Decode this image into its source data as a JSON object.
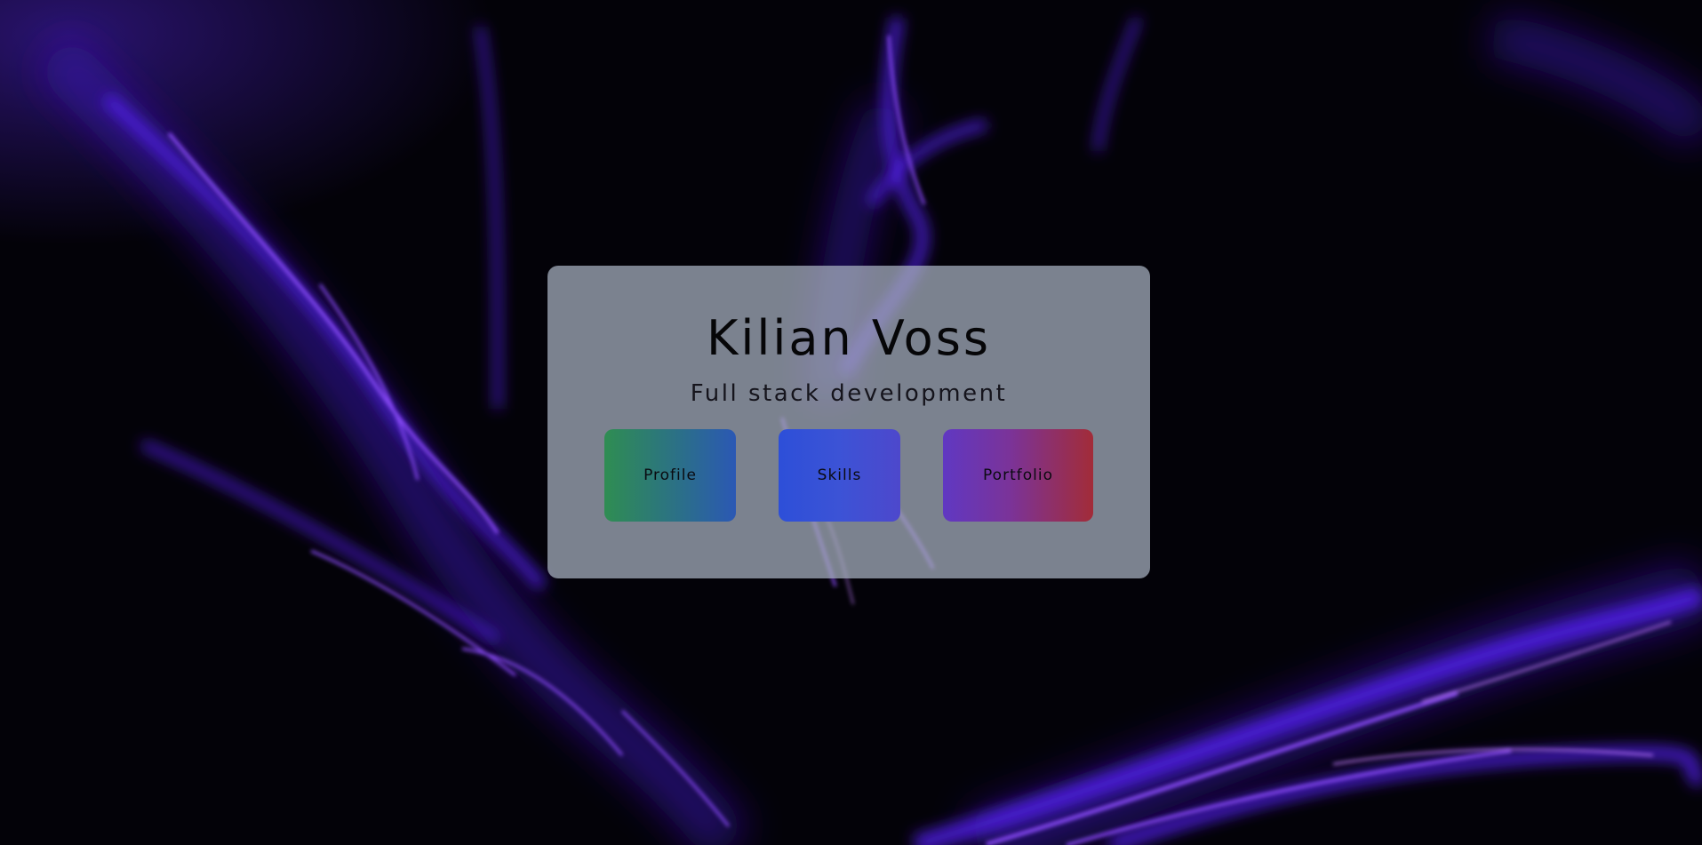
{
  "hero": {
    "name": "Kilian Voss",
    "tagline": "Full stack development"
  },
  "nav_buttons": [
    {
      "label": "Profile"
    },
    {
      "label": "Skills"
    },
    {
      "label": "Portfolio"
    }
  ],
  "colors": {
    "background": "#030208",
    "glow": "#6a2cff",
    "card": "#aab4c4"
  }
}
